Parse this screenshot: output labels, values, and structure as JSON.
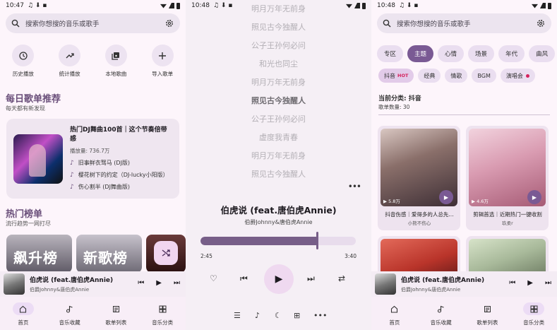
{
  "panel1": {
    "status": {
      "time": "10:47",
      "icons": "♫ ⬇ ▪"
    },
    "search_placeholder": "搜索你想搜的音乐或歌手",
    "quick": [
      {
        "label": "历史播放",
        "icon": "history-icon"
      },
      {
        "label": "统计播放",
        "icon": "trending-icon"
      },
      {
        "label": "本地歌曲",
        "icon": "library-icon"
      },
      {
        "label": "导入歌单",
        "icon": "add-icon"
      }
    ],
    "daily": {
      "title": "每日歌单推荐",
      "subtitle": "每天都有新发现",
      "card": {
        "title": "热门DJ舞曲100首｜这个节奏倍带感",
        "plays": "播放量: 736.7万",
        "songs": [
          "旧事鲜衣驽马 (DJ版)",
          "樱花树下的约定（DJ-lucky小阳版）",
          "伤心割半 (DJ舞曲版)"
        ]
      }
    },
    "hot": {
      "title": "热门榜单",
      "subtitle": "流行趋势一网打尽",
      "tiles": [
        "飙升榜",
        "新歌榜"
      ]
    }
  },
  "mini_player": {
    "title": "伯虎说 (feat.唐伯虎Annie)",
    "artist": "伯爵Johnny&唐伯虎Annie",
    "prev": "⏮",
    "play": "▶",
    "next": "⏭"
  },
  "nav": [
    {
      "label": "首页",
      "icon": "home-icon"
    },
    {
      "label": "音乐收藏",
      "icon": "favorite-music-icon"
    },
    {
      "label": "歌单列表",
      "icon": "playlist-icon"
    },
    {
      "label": "音乐分类",
      "icon": "grid-icon"
    }
  ],
  "panel2": {
    "status": {
      "time": "10:48",
      "icons": "♫ ⬇ ▪"
    },
    "lyrics": [
      "明月万年无前身",
      "照见古今独醒人",
      "公子王孙何必问",
      "和光也同尘",
      "明月万年无前身",
      "照见古今独醒人",
      "公子王孙何必问",
      "虚度我青春",
      "明月万年无前身",
      "照见古今独醒人"
    ],
    "current_index": 5,
    "more": "•••",
    "song_title": "伯虎说 (feat.唐伯虎Annie)",
    "artist": "伯爵Johnny&唐伯虎Annie",
    "elapsed": "2:45",
    "duration": "3:40",
    "progress": 0.75,
    "controls": {
      "like": "♡",
      "prev": "⏮",
      "play": "▶",
      "next": "⏭",
      "repeat": "⇄"
    },
    "bottom": {
      "queue": "☰",
      "lyrics": "♪",
      "sleep": "☾",
      "add": "⊞",
      "more": "•••"
    }
  },
  "panel3": {
    "status": {
      "time": "10:48",
      "icons": "♫ ⬇ ▪"
    },
    "search_placeholder": "搜索你想搜的音乐或歌手",
    "tabs": [
      "专区",
      "主题",
      "心情",
      "场景",
      "年代",
      "曲风"
    ],
    "active_tab": 1,
    "chips": [
      {
        "label": "抖音",
        "badge": "HOT"
      },
      {
        "label": "经典"
      },
      {
        "label": "情歌"
      },
      {
        "label": "BGM"
      },
      {
        "label": "演唱会",
        "dot": true
      }
    ],
    "current_category": "当前分类: 抖音",
    "count": "歌单数量: 30",
    "cards": [
      {
        "plays": "▶ 5.8万",
        "title": "抖音伤感｜爱得多的人总先...",
        "subtitle": "小熊不伤心"
      },
      {
        "plays": "▶ 4.6万",
        "title": "剪辑首选｜近期热门一键收割",
        "subtitle": "玖柔r"
      }
    ]
  }
}
